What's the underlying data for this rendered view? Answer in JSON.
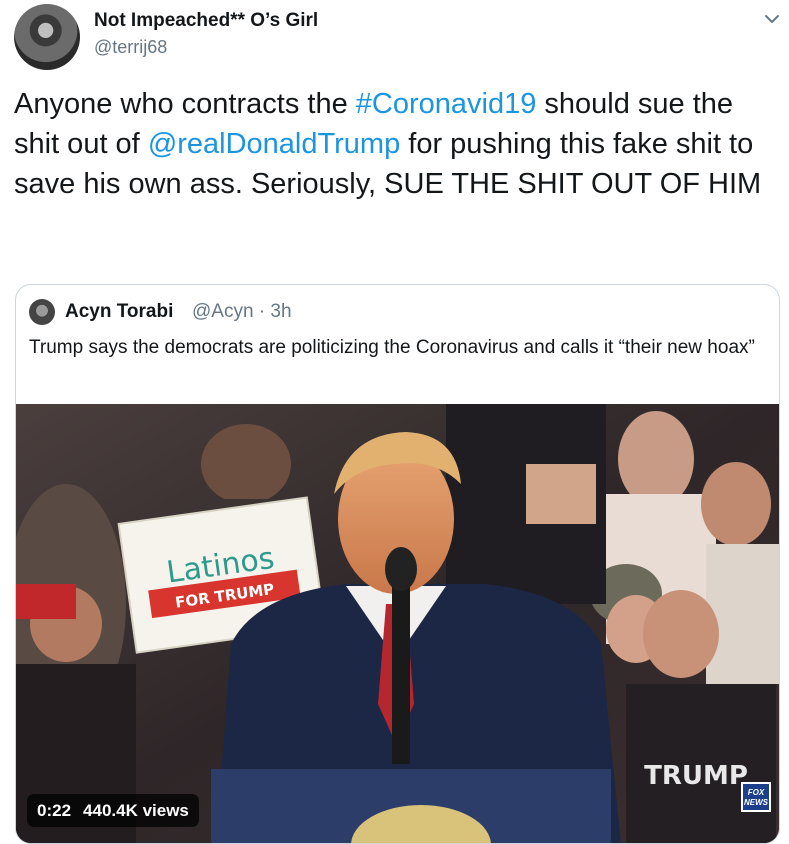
{
  "author": {
    "display_name": "Not Impeached** O’s Girl",
    "handle": "@terrij68"
  },
  "tweet": {
    "text_part1": "Anyone who contracts the ",
    "hashtag": "#Coronavid19",
    "text_part2": " should sue the shit out of ",
    "mention": "@realDonaldTrump",
    "text_part3": " for pushing this fake shit to save his own ass. Seriously, SUE THE SHIT OUT OF HIM"
  },
  "quoted": {
    "display_name": "Acyn Torabi",
    "handle_time": "@Acyn · 3h",
    "text": "Trump says the democrats are politicizing the Coronavirus and calls it “their new hoax”"
  },
  "video": {
    "duration": "0:22",
    "views": "440.4K views",
    "sign_line1": "Latinos",
    "sign_line2": "FOR TRUMP",
    "shirt_text": "TRUMP",
    "logo_text": "FOX NEWS"
  },
  "colors": {
    "link": "#1b95e0",
    "secondary_text": "#657786",
    "border": "#ccd6dd"
  },
  "icons": {
    "caret": "chevron-down-icon"
  }
}
